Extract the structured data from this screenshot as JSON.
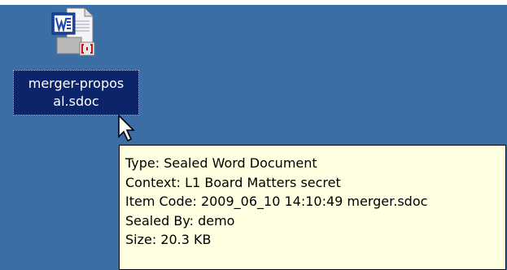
{
  "desktop": {
    "background_color": "#3a6ea5",
    "file": {
      "icon": "sealed-word-document-icon",
      "label_line1": "merger-propos",
      "label_line2": "al.sdoc"
    }
  },
  "tooltip": {
    "lines": [
      "Type: Sealed Word Document",
      "Context: L1 Board Matters secret",
      "Item Code: 2009_06_10 14:10:49 merger.sdoc",
      "Sealed By: demo",
      "Size: 20.3 KB"
    ]
  },
  "cursor": {
    "icon": "arrow-cursor-icon"
  }
}
